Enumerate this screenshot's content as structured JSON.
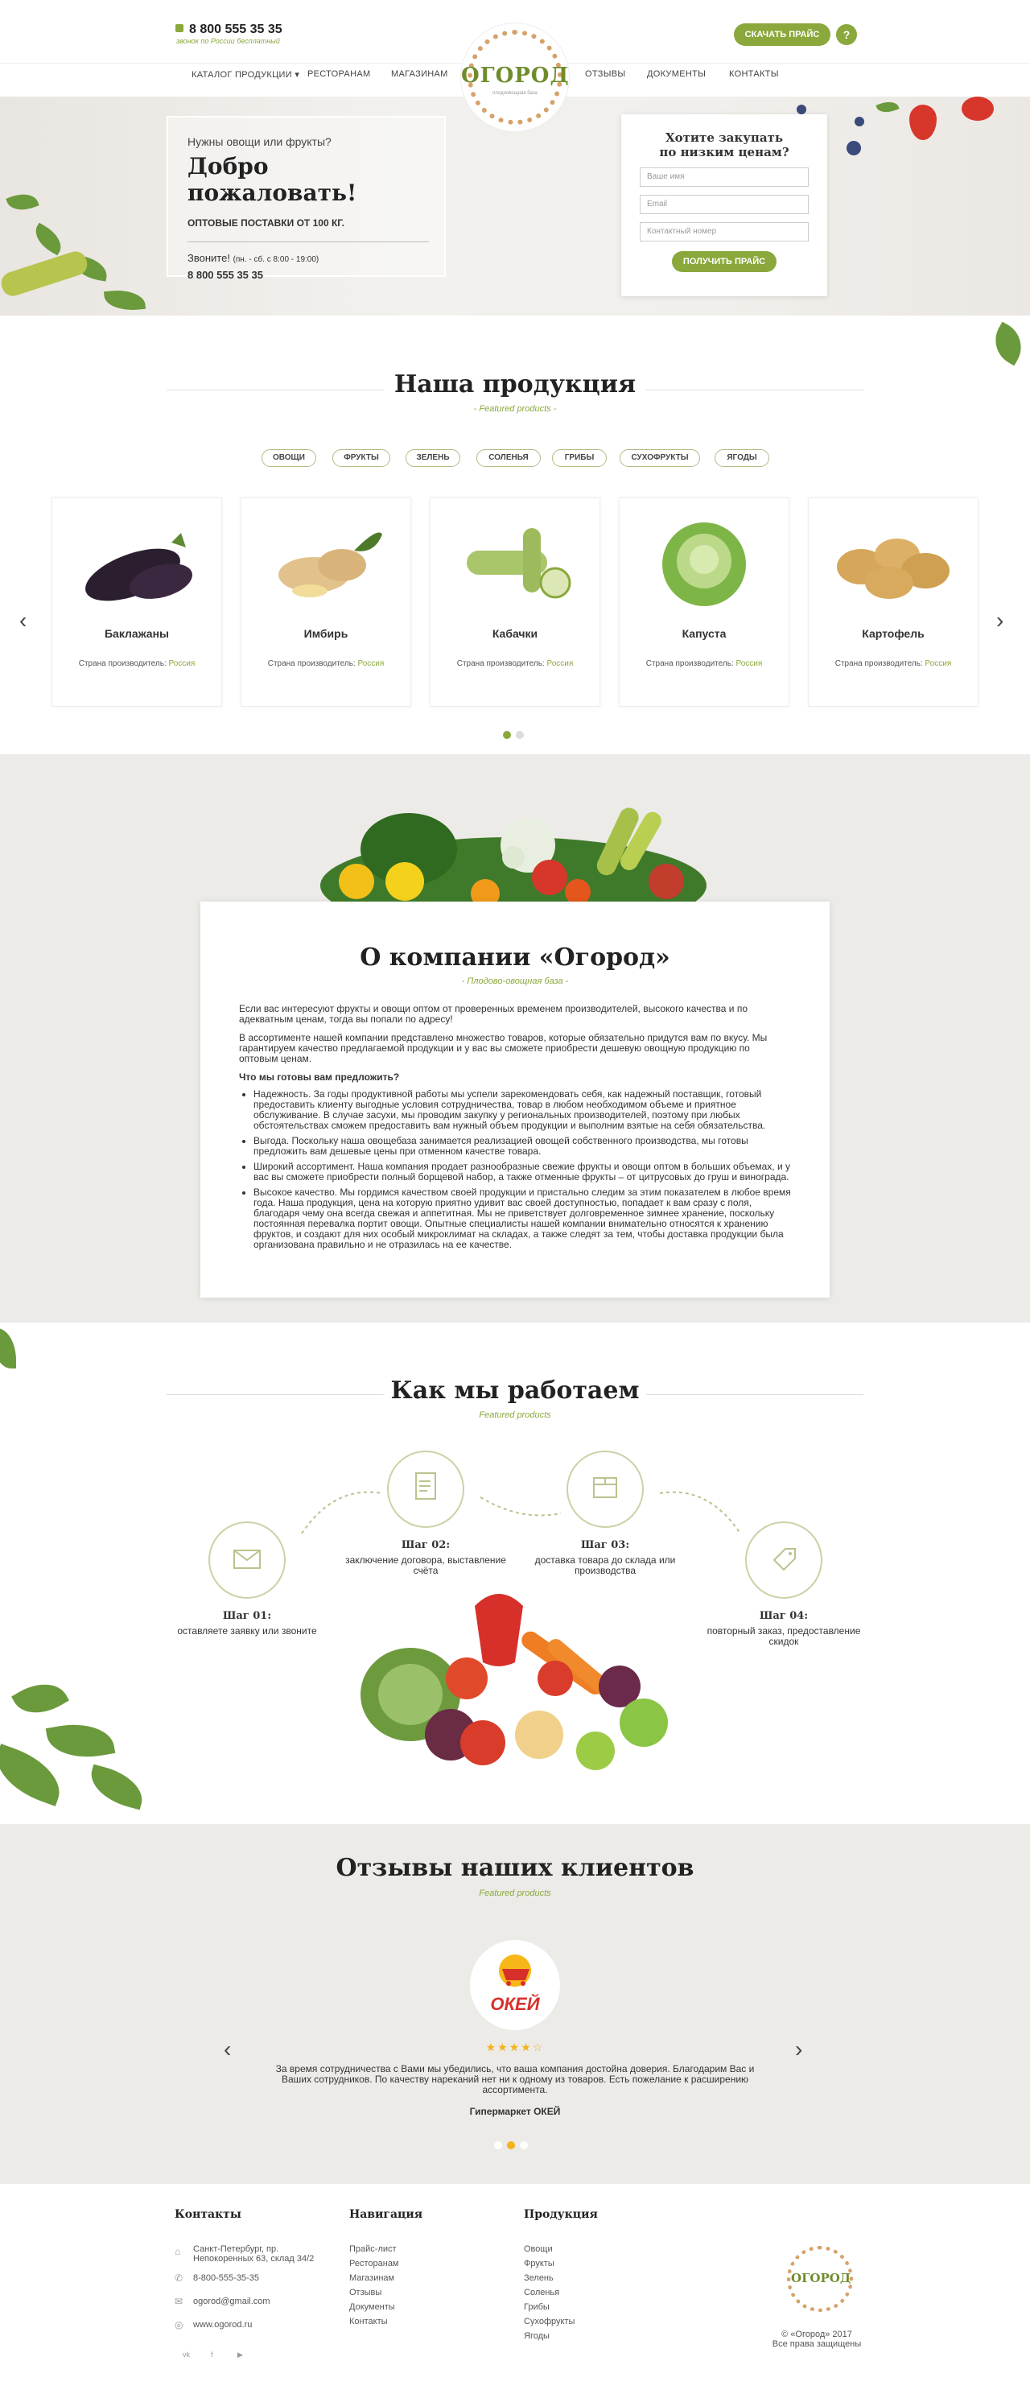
{
  "header": {
    "phone": "8 800 555 35 35",
    "phone_sub": "звонок по России бесплатный",
    "logo_name": "ОГОРОД",
    "logo_sub": "плодоовощная база",
    "price_button": "СКАЧАТЬ ПРАЙС",
    "help": "?",
    "nav": [
      "КАТАЛОГ ПРОДУКЦИИ",
      "РЕСТОРАНАМ",
      "МАГАЗИНАМ",
      "ОТЗЫВЫ",
      "ДОКУМЕНТЫ",
      "КОНТАКТЫ"
    ],
    "dropdown_icon": "▾"
  },
  "hero": {
    "question": "Нужны овощи или фрукты?",
    "welcome": "Добро пожаловать!",
    "wholesale": "ОПТОВЫЕ ПОСТАВКИ ОТ 100 КГ.",
    "call": "Звоните!",
    "hours": "(пн. - сб. с 8:00 - 19:00)",
    "phone": "8 800 555 35 35"
  },
  "form": {
    "title_1": "Хотите закупать",
    "title_2": "по низким ценам?",
    "name_placeholder": "Ваше имя",
    "email_placeholder": "Email",
    "phone_placeholder": "Контактный номер",
    "submit": "ПОЛУЧИТЬ ПРАЙС"
  },
  "products": {
    "title": "Наша продукция",
    "subtitle": "- Featured products -",
    "categories": [
      "ОВОЩИ",
      "ФРУКТЫ",
      "ЗЕЛЕНЬ",
      "СОЛЕНЬЯ",
      "ГРИБЫ",
      "СУХОФРУКТЫ",
      "ЯГОДЫ"
    ],
    "country_label": "Страна производитель:",
    "items": [
      {
        "name": "Баклажаны",
        "country": "Россия"
      },
      {
        "name": "Имбирь",
        "country": "Россия"
      },
      {
        "name": "Кабачки",
        "country": "Россия"
      },
      {
        "name": "Капуста",
        "country": "Россия"
      },
      {
        "name": "Картофель",
        "country": "Россия"
      }
    ],
    "prev": "‹",
    "next": "›"
  },
  "about": {
    "title": "О компании «Огород»",
    "subtitle": "- Плодово-овощная база -",
    "p1": "Если вас интересуют фрукты и овощи оптом от проверенных временем производителей, высокого качества и по адекватным ценам, тогда вы попали по адресу!",
    "p2": "В ассортименте нашей компании представлено множество товаров, которые обязательно придутся вам по вкусу. Мы гарантируем качество предлагаемой продукции и у вас вы сможете приобрести дешевую овощную продукцию по оптовым ценам.",
    "question": "Что мы готовы вам предложить?",
    "list": [
      "Надежность. За годы продуктивной работы мы успели зарекомендовать себя, как надежный поставщик, готовый предоставить клиенту выгодные условия сотрудничества, товар в любом необходимом объеме и приятное обслуживание. В случае засухи, мы проводим закупку у региональных производителей, поэтому при любых обстоятельствах сможем предоставить вам нужный объем продукции и выполним взятые на себя обязательства.",
      "Выгода. Поскольку наша овощебаза занимается реализацией овощей собственного производства, мы готовы предложить вам дешевые цены при отменном качестве товара.",
      "Широкий ассортимент. Наша компания продает разнообразные свежие фрукты и овощи оптом в больших объемах, и у вас вы сможете приобрести полный борщевой набор, а также отменные фрукты – от цитрусовых до груш и винограда.",
      "Высокое качество. Мы гордимся качеством своей продукции и пристально следим за этим показателем в любое время года. Наша продукция, цена на которую приятно удивит вас своей доступностью, попадает к вам сразу с поля, благодаря чему она всегда свежая и аппетитная. Мы не приветствует долговременное зимнее хранение, поскольку постоянная перевалка портит овощи. Опытные специалисты нашей компании внимательно относятся к хранению фруктов, и создают для них особый микроклимат на складах, а также следят за тем, чтобы доставка продукции была организована правильно и не отразилась на ее качестве."
    ]
  },
  "how": {
    "title": "Как мы работаем",
    "subtitle": "Featured products",
    "steps": [
      {
        "title": "Шаг 01:",
        "desc": "оставляете заявку или звоните"
      },
      {
        "title": "Шаг 02:",
        "desc": "заключение договора, выставление счёта"
      },
      {
        "title": "Шаг 03:",
        "desc": "доставка товара до склада или производства"
      },
      {
        "title": "Шаг 04:",
        "desc": "повторный заказ, предоставление скидок"
      }
    ]
  },
  "reviews": {
    "title": "Отзывы наших клиентов",
    "subtitle": "Featured products",
    "brand": "ОКЕЙ",
    "stars": "★★★★☆",
    "text": "За время сотрудничества с Вами мы убедились, что ваша компания достойна доверия. Благодарим Вас и Ваших сотрудников. По качеству нареканий нет ни к одному из товаров. Есть пожелание к расширению ассортимента.",
    "author": "Гипермаркет ОКЕЙ",
    "prev": "‹",
    "next": "›"
  },
  "footer": {
    "contacts_title": "Контакты",
    "address": "Санкт-Петербург, пр. Непокоренных 63, склад 34/2",
    "phone": "8-800-555-35-35",
    "email": "ogorod@gmail.com",
    "site": "www.ogorod.ru",
    "nav_title": "Навигация",
    "nav": [
      "Прайс-лист",
      "Ресторанам",
      "Магазинам",
      "Отзывы",
      "Документы",
      "Контакты"
    ],
    "prod_title": "Продукция",
    "prod": [
      "Овощи",
      "Фрукты",
      "Зелень",
      "Соленья",
      "Грибы",
      "Сухофрукты",
      "Ягоды"
    ],
    "copyright": "© «Огород» 2017",
    "rights": "Все права защищены",
    "logo_name": "ОГОРОД",
    "social": [
      "vk",
      "f",
      "▶"
    ]
  },
  "colors": {
    "accent": "#8aa83b",
    "bg_gray": "#ecebe8"
  }
}
